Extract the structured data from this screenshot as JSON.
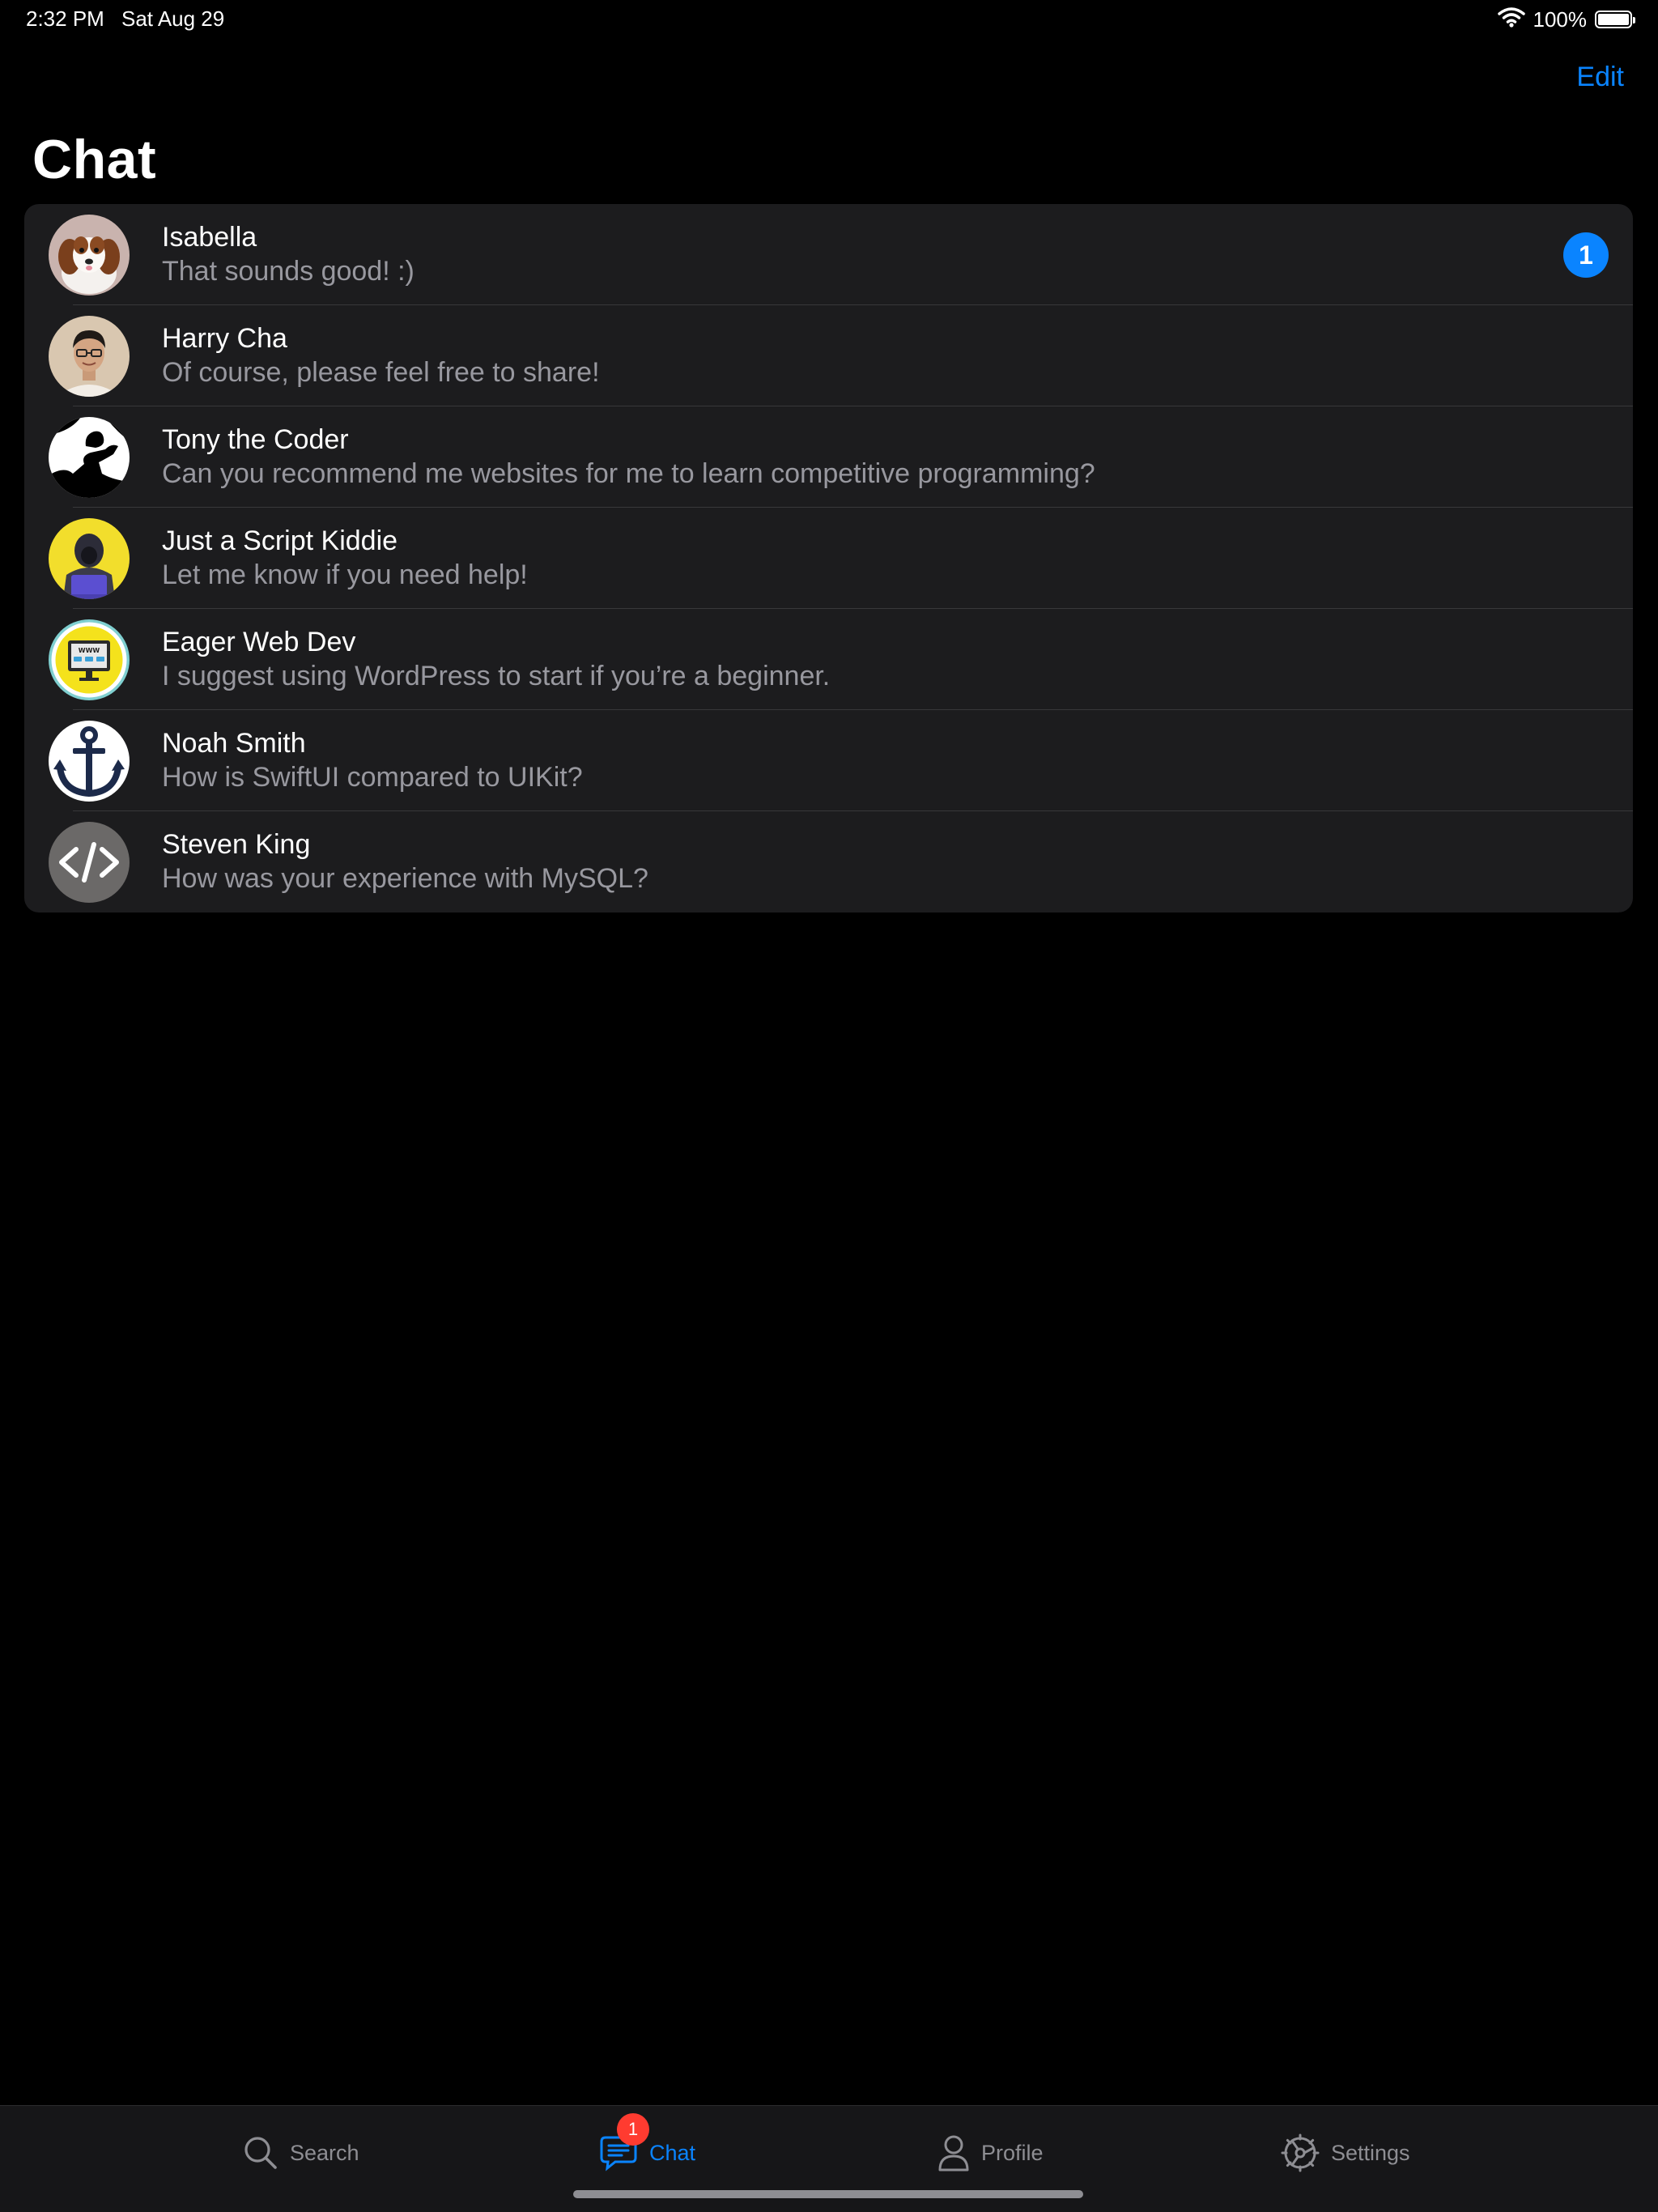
{
  "status_bar": {
    "time": "2:32 PM",
    "date": "Sat Aug 29",
    "battery_text": "100%",
    "battery_level": 1.0,
    "icons": [
      "wifi-icon",
      "battery-icon"
    ]
  },
  "nav": {
    "edit_label": "Edit",
    "title": "Chat"
  },
  "chats": [
    {
      "name": "Isabella",
      "preview": "That sounds good!  :)",
      "unread": "1",
      "avatar": "puppy-avatar"
    },
    {
      "name": "Harry Cha",
      "preview": "Of course, please feel free to share!",
      "avatar": "person-photo-avatar"
    },
    {
      "name": "Tony the Coder",
      "preview": "Can you recommend me websites for me to learn competitive programming?",
      "avatar": "silhouette-avatar"
    },
    {
      "name": "Just a Script Kiddie",
      "preview": "Let me know if you need help!",
      "avatar": "hacker-avatar"
    },
    {
      "name": "Eager Web Dev",
      "preview": "I suggest using WordPress to start if you’re a beginner.",
      "avatar": "www-monitor-avatar"
    },
    {
      "name": "Noah Smith",
      "preview": "How is SwiftUI compared to UIKit?",
      "avatar": "anchor-avatar"
    },
    {
      "name": "Steven King",
      "preview": "How was your experience with MySQL?",
      "avatar": "code-brackets-avatar"
    }
  ],
  "tab_bar": {
    "search_label": "Search",
    "chat_label": "Chat",
    "chat_badge": "1",
    "profile_label": "Profile",
    "settings_label": "Settings",
    "active_tab": "Chat"
  },
  "colors": {
    "accent": "#0a84ff",
    "badge_red": "#ff3b30",
    "background": "#000000",
    "list_background": "#1c1c1e",
    "secondary_text": "#98989f"
  }
}
